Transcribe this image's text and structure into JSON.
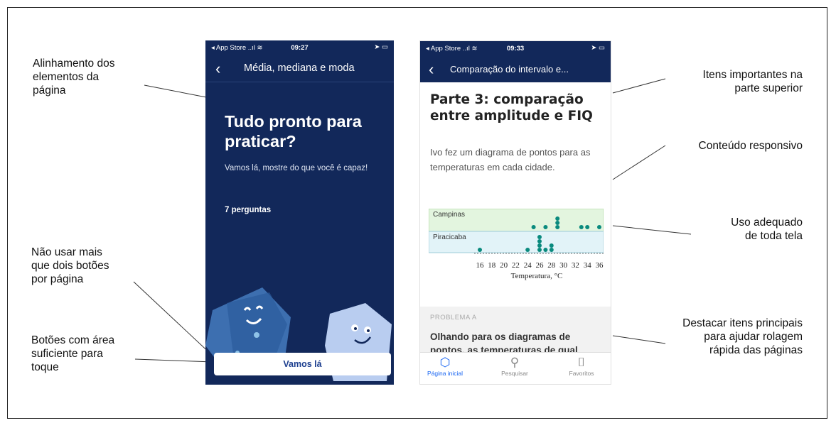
{
  "annotations": {
    "left": [
      {
        "text": "Alinhamento dos\nelementos da\npágina"
      },
      {
        "text": "Não usar mais\nque dois botões\npor página"
      },
      {
        "text": "Botões com área\nsuficiente para\ntoque"
      }
    ],
    "right": [
      {
        "text": "Itens importantes na\nparte superior"
      },
      {
        "text": "Conteúdo responsivo"
      },
      {
        "text": "Uso adequado\nde toda tela"
      },
      {
        "text": "Destacar itens principais\npara ajudar rolagem\nrápida das páginas"
      }
    ]
  },
  "phone1": {
    "status": {
      "left": "◂ App Store ..ıl ≋",
      "time": "09:27",
      "right": "➤ ▭"
    },
    "nav_title": "Média, mediana e moda",
    "heading": "Tudo pronto para praticar?",
    "subtext": "Vamos lá, mostre do que você é capaz!",
    "question_count": "7 perguntas",
    "button_label": "Vamos lá"
  },
  "phone2": {
    "status": {
      "left": "◂ App Store ..ıl ≋",
      "time": "09:33",
      "right": "➤ ▭"
    },
    "nav_title": "Comparação do intervalo e...",
    "heading": "Parte 3: comparação entre amplitude e FIQ",
    "body": "Ivo fez um diagrama de pontos para as temperaturas em cada cidade.",
    "problem_tag": "PROBLEMA A",
    "problem_text": "Olhando para os diagramas de pontos, as temperaturas de qual",
    "tabs": [
      {
        "label": "Página inicial",
        "icon": "home-hexagon-icon",
        "active": true
      },
      {
        "label": "Pesquisar",
        "icon": "search-icon",
        "active": false
      },
      {
        "label": "Favoritos",
        "icon": "bookmark-icon",
        "active": false
      }
    ]
  },
  "chart_data": {
    "type": "scatter",
    "xlabel": "Temperatura, °C",
    "tick_labels": [
      "16",
      "18",
      "20",
      "22",
      "24",
      "26",
      "28",
      "30",
      "32",
      "34",
      "36"
    ],
    "xlim": [
      16,
      36
    ],
    "series": [
      {
        "name": "Campinas",
        "values": [
          25,
          27,
          29,
          29,
          29,
          33,
          34,
          36
        ]
      },
      {
        "name": "Piracicaba",
        "values": [
          16,
          24,
          26,
          26,
          26,
          26,
          27,
          28,
          28
        ]
      }
    ],
    "colors": {
      "campinas_bg": "#e3f5df",
      "piracicaba_bg": "#e2f3f8",
      "dot": "#0a8a7e"
    }
  },
  "colors": {
    "navy": "#12285a",
    "accent": "#1865f2"
  }
}
